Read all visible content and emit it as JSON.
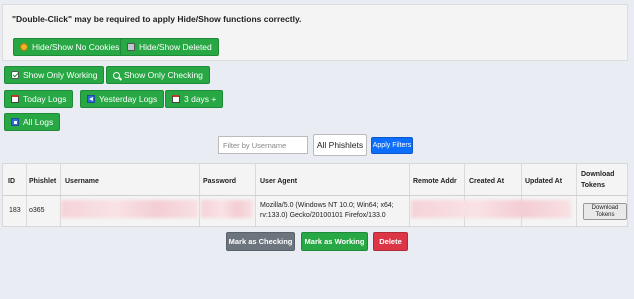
{
  "notice": "\"Double-Click\" may be required to apply Hide/Show functions correctly.",
  "buttons": {
    "hide_show_no_cookies": "Hide/Show No Cookies",
    "hide_show_deleted": "Hide/Show Deleted",
    "show_only_working": "Show Only Working",
    "show_only_checking": "Show Only Checking",
    "today_logs": "Today Logs",
    "yesterday_logs": "Yesterday Logs",
    "three_days": "3 days +",
    "all_logs": "All Logs"
  },
  "filter": {
    "username_placeholder": "Filter by Username",
    "phishlet_selected": "All Phishlets",
    "apply_label": "Apply Filters"
  },
  "table": {
    "headers": {
      "id": "ID",
      "phishlet": "Phishlet",
      "username": "Username",
      "password": "Password",
      "user_agent": "User Agent",
      "remote_addr": "Remote Addr",
      "created_at": "Created At",
      "updated_at": "Updated At",
      "download_tokens_line1": "Download",
      "download_tokens_line2": "Tokens"
    },
    "row": {
      "id": "183",
      "phishlet": "o365",
      "user_agent_line1": "Mozilla/5.0 (Windows NT 10.0; Win64; x64;",
      "user_agent_line2": "rv:133.0) Gecko/20100101 Firefox/133.0",
      "download_line1": "Download",
      "download_line2": "Tokens"
    }
  },
  "actions": {
    "mark_checking": "Mark as Checking",
    "mark_working": "Mark as Working",
    "delete": "Delete"
  },
  "colors": {
    "green": "#28a745",
    "blue": "#0d6efd",
    "grey": "#6c757d",
    "red": "#dc3545"
  }
}
